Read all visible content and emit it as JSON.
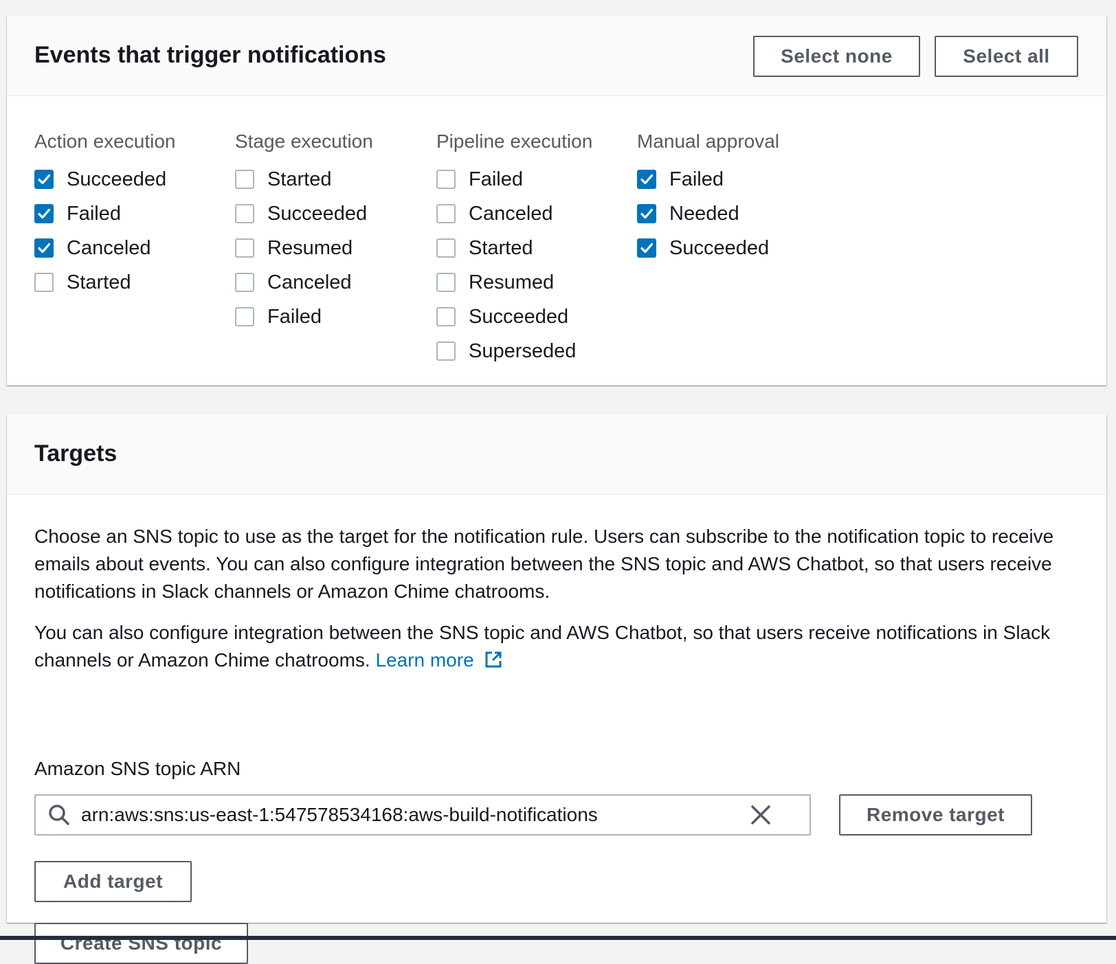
{
  "events": {
    "title": "Events that trigger notifications",
    "select_none_label": "Select none",
    "select_all_label": "Select all",
    "columns": [
      {
        "title": "Action execution",
        "items": [
          {
            "label": "Succeeded",
            "checked": true
          },
          {
            "label": "Failed",
            "checked": true
          },
          {
            "label": "Canceled",
            "checked": true
          },
          {
            "label": "Started",
            "checked": false
          }
        ]
      },
      {
        "title": "Stage execution",
        "items": [
          {
            "label": "Started",
            "checked": false
          },
          {
            "label": "Succeeded",
            "checked": false
          },
          {
            "label": "Resumed",
            "checked": false
          },
          {
            "label": "Canceled",
            "checked": false
          },
          {
            "label": "Failed",
            "checked": false
          }
        ]
      },
      {
        "title": "Pipeline execution",
        "items": [
          {
            "label": "Failed",
            "checked": false
          },
          {
            "label": "Canceled",
            "checked": false
          },
          {
            "label": "Started",
            "checked": false
          },
          {
            "label": "Resumed",
            "checked": false
          },
          {
            "label": "Succeeded",
            "checked": false
          },
          {
            "label": "Superseded",
            "checked": false
          }
        ]
      },
      {
        "title": "Manual approval",
        "items": [
          {
            "label": "Failed",
            "checked": true
          },
          {
            "label": "Needed",
            "checked": true
          },
          {
            "label": "Succeeded",
            "checked": true
          }
        ]
      }
    ]
  },
  "targets": {
    "title": "Targets",
    "description_1": "Choose an SNS topic to use as the target for the notification rule. Users can subscribe to the notification topic to receive emails about events. You can also configure integration between the SNS topic and AWS Chatbot, so that users receive notifications in Slack channels or Amazon Chime chatrooms.",
    "description_2": "You can also configure integration between the SNS topic and AWS Chatbot, so that users receive notifications in Slack channels or Amazon Chime chatrooms.",
    "learn_more_label": "Learn more",
    "field_label": "Amazon SNS topic ARN",
    "topic_arn_value": "arn:aws:sns:us-east-1:547578534168:aws-build-notifications",
    "remove_target_label": "Remove target",
    "add_target_label": "Add target",
    "create_topic_label": "Create SNS topic"
  },
  "icons": {
    "checkbox_checked": "checkmark-icon",
    "search": "search-icon",
    "clear": "close-icon",
    "external_link": "external-link-icon"
  },
  "colors": {
    "accent": "#0073bb",
    "checkbox_border": "#aab7b8",
    "button_text": "#545b64",
    "text": "#16191f",
    "page_background": "#f2f3f3"
  }
}
